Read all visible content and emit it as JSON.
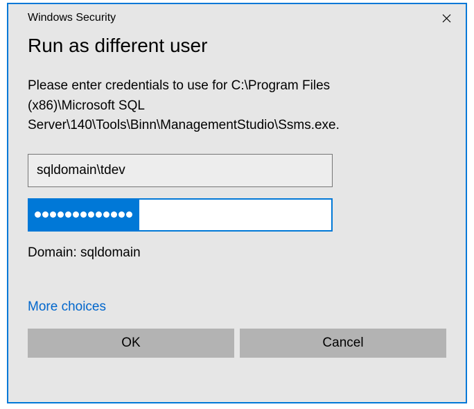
{
  "titlebar": {
    "title": "Windows Security"
  },
  "dialog": {
    "heading": "Run as different user",
    "instruction": "Please enter credentials to use for C:\\Program Files (x86)\\Microsoft SQL Server\\140\\Tools\\Binn\\ManagementStudio\\Ssms.exe.",
    "username_value": "sqldomain\\tdev",
    "password_length": 13,
    "domain_label": "Domain: sqldomain",
    "more_choices_label": "More choices",
    "ok_label": "OK",
    "cancel_label": "Cancel"
  }
}
